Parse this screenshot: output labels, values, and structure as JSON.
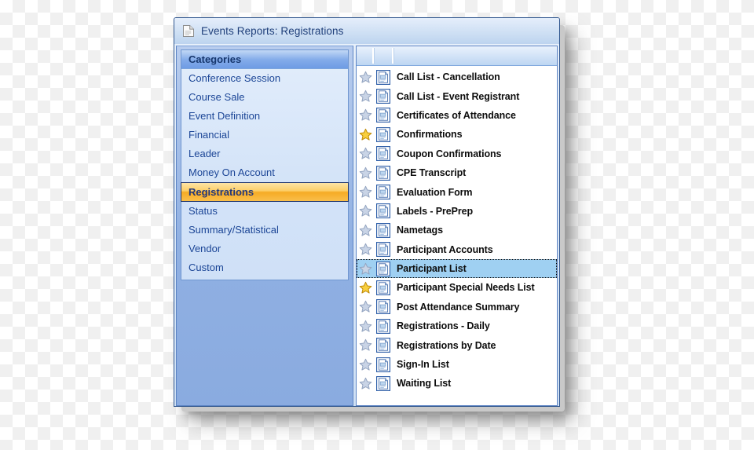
{
  "window": {
    "title": "Events Reports: Registrations",
    "title_icon": "document-icon"
  },
  "sidebar": {
    "header": "Categories",
    "selected": "Registrations",
    "items": [
      {
        "label": "Conference Session",
        "selected": false
      },
      {
        "label": "Course Sale",
        "selected": false
      },
      {
        "label": "Event Definition",
        "selected": false
      },
      {
        "label": "Financial",
        "selected": false
      },
      {
        "label": "Leader",
        "selected": false
      },
      {
        "label": "Money On Account",
        "selected": false
      },
      {
        "label": "Registrations",
        "selected": true
      },
      {
        "label": "Status",
        "selected": false
      },
      {
        "label": "Summary/Statistical",
        "selected": false
      },
      {
        "label": "Vendor",
        "selected": false
      },
      {
        "label": "Custom",
        "selected": false
      }
    ]
  },
  "report_list": {
    "header_columns": [
      "",
      "",
      ""
    ],
    "selected": "Participant List",
    "rows": [
      {
        "label": "Call List - Cancellation",
        "favorite": false,
        "selected": false,
        "star_icon": "star-icon",
        "doc_icon": "report-document-icon"
      },
      {
        "label": "Call List - Event Registrant",
        "favorite": false,
        "selected": false,
        "star_icon": "star-icon",
        "doc_icon": "report-document-icon"
      },
      {
        "label": "Certificates of Attendance",
        "favorite": false,
        "selected": false,
        "star_icon": "star-icon",
        "doc_icon": "report-document-icon"
      },
      {
        "label": "Confirmations",
        "favorite": true,
        "selected": false,
        "star_icon": "star-icon",
        "doc_icon": "report-document-icon"
      },
      {
        "label": "Coupon Confirmations",
        "favorite": false,
        "selected": false,
        "star_icon": "star-icon",
        "doc_icon": "report-document-icon"
      },
      {
        "label": "CPE Transcript",
        "favorite": false,
        "selected": false,
        "star_icon": "star-icon",
        "doc_icon": "report-document-icon"
      },
      {
        "label": "Evaluation Form",
        "favorite": false,
        "selected": false,
        "star_icon": "star-icon",
        "doc_icon": "report-document-icon"
      },
      {
        "label": "Labels - PrePrep",
        "favorite": false,
        "selected": false,
        "star_icon": "star-icon",
        "doc_icon": "report-document-icon"
      },
      {
        "label": "Nametags",
        "favorite": false,
        "selected": false,
        "star_icon": "star-icon",
        "doc_icon": "report-document-icon"
      },
      {
        "label": "Participant Accounts",
        "favorite": false,
        "selected": false,
        "star_icon": "star-icon",
        "doc_icon": "report-document-icon"
      },
      {
        "label": "Participant List",
        "favorite": false,
        "selected": true,
        "star_icon": "star-icon",
        "doc_icon": "report-document-icon"
      },
      {
        "label": "Participant Special Needs List",
        "favorite": true,
        "selected": false,
        "star_icon": "star-icon",
        "doc_icon": "report-document-icon"
      },
      {
        "label": "Post Attendance Summary",
        "favorite": false,
        "selected": false,
        "star_icon": "star-icon",
        "doc_icon": "report-document-icon"
      },
      {
        "label": "Registrations - Daily",
        "favorite": false,
        "selected": false,
        "star_icon": "star-icon",
        "doc_icon": "report-document-icon"
      },
      {
        "label": "Registrations by Date",
        "favorite": false,
        "selected": false,
        "star_icon": "star-icon",
        "doc_icon": "report-document-icon"
      },
      {
        "label": "Sign-In List",
        "favorite": false,
        "selected": false,
        "star_icon": "star-icon",
        "doc_icon": "report-document-icon"
      },
      {
        "label": "Waiting List",
        "favorite": false,
        "selected": false,
        "star_icon": "star-icon",
        "doc_icon": "report-document-icon"
      }
    ]
  },
  "colors": {
    "accent_selected_category": "#f6ab24",
    "accent_selected_row": "#9fd0f2",
    "favorite_star": "#f5c11e",
    "inactive_star": "#adbcd6",
    "title_text": "#1f3f7a",
    "category_text": "#1b4596"
  }
}
